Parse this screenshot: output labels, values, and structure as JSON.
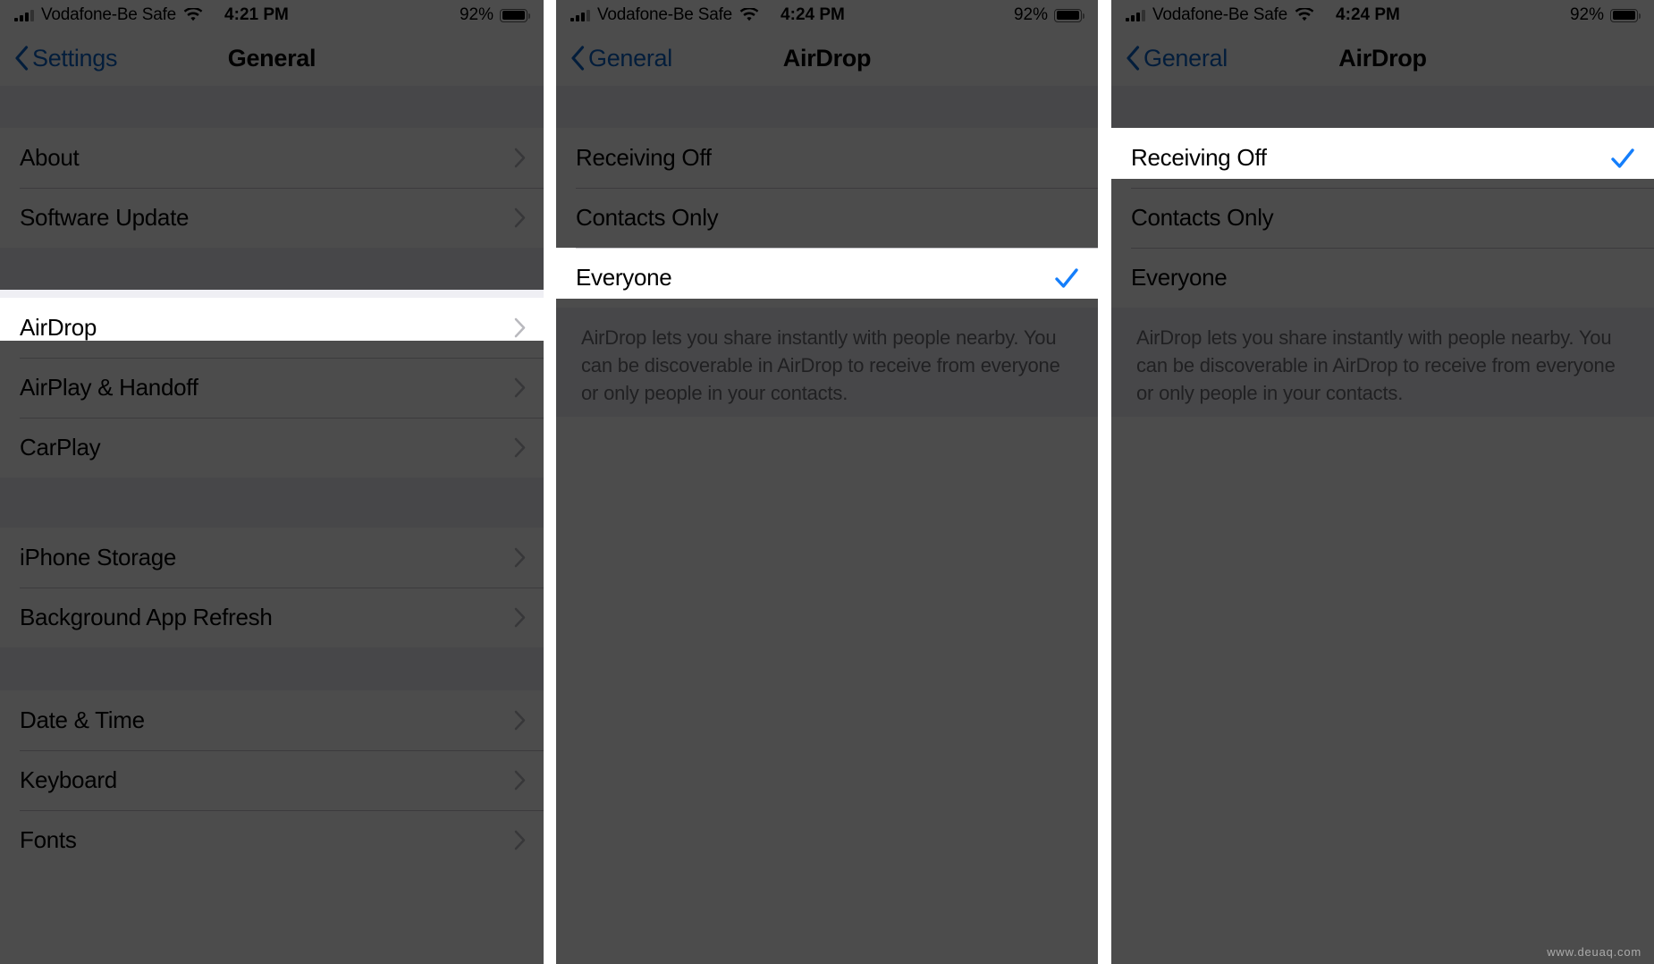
{
  "accent_blue": "#0b63c5",
  "check_blue": "#147efb",
  "dim_color": "rgba(0,0,0,0.70)",
  "watermark": "www.deuaq.com",
  "panels": [
    {
      "id": "general-settings",
      "status": {
        "carrier": "Vodafone-Be Safe",
        "time": "4:21 PM",
        "battery_percent": "92%",
        "signal_icon": "cellular-signal-icon",
        "wifi_icon": "wifi-icon",
        "battery_icon": "battery-icon"
      },
      "nav": {
        "back_label": "Settings",
        "title": "General",
        "back_icon": "chevron-left-icon"
      },
      "groups": [
        {
          "rows": [
            {
              "label": "About",
              "accessory": "chevron-right-icon",
              "highlighted": false
            },
            {
              "label": "Software Update",
              "accessory": "chevron-right-icon",
              "highlighted": false
            }
          ]
        },
        {
          "rows": [
            {
              "label": "AirDrop",
              "accessory": "chevron-right-icon",
              "highlighted": true
            },
            {
              "label": "AirPlay & Handoff",
              "accessory": "chevron-right-icon",
              "highlighted": false
            },
            {
              "label": "CarPlay",
              "accessory": "chevron-right-icon",
              "highlighted": false
            }
          ]
        },
        {
          "rows": [
            {
              "label": "iPhone Storage",
              "accessory": "chevron-right-icon",
              "highlighted": false
            },
            {
              "label": "Background App Refresh",
              "accessory": "chevron-right-icon",
              "highlighted": false
            }
          ]
        },
        {
          "rows": [
            {
              "label": "Date & Time",
              "accessory": "chevron-right-icon",
              "highlighted": false
            },
            {
              "label": "Keyboard",
              "accessory": "chevron-right-icon",
              "highlighted": false
            },
            {
              "label": "Fonts",
              "accessory": "chevron-right-icon",
              "highlighted": false
            }
          ]
        }
      ]
    },
    {
      "id": "airdrop-everyone",
      "status": {
        "carrier": "Vodafone-Be Safe",
        "time": "4:24 PM",
        "battery_percent": "92%",
        "signal_icon": "cellular-signal-icon",
        "wifi_icon": "wifi-icon",
        "battery_icon": "battery-icon"
      },
      "nav": {
        "back_label": "General",
        "title": "AirDrop",
        "back_icon": "chevron-left-icon"
      },
      "groups": [
        {
          "rows": [
            {
              "label": "Receiving Off",
              "accessory": "none",
              "highlighted": false,
              "checked": false
            },
            {
              "label": "Contacts Only",
              "accessory": "none",
              "highlighted": false,
              "checked": false
            },
            {
              "label": "Everyone",
              "accessory": "checkmark-icon",
              "highlighted": true,
              "checked": true
            }
          ]
        }
      ],
      "footnote": "AirDrop lets you share instantly with people nearby. You can be discoverable in AirDrop to receive from everyone or only people in your contacts."
    },
    {
      "id": "airdrop-receiving-off",
      "status": {
        "carrier": "Vodafone-Be Safe",
        "time": "4:24 PM",
        "battery_percent": "92%",
        "signal_icon": "cellular-signal-icon",
        "wifi_icon": "wifi-icon",
        "battery_icon": "battery-icon"
      },
      "nav": {
        "back_label": "General",
        "title": "AirDrop",
        "back_icon": "chevron-left-icon"
      },
      "groups": [
        {
          "rows": [
            {
              "label": "Receiving Off",
              "accessory": "checkmark-icon",
              "highlighted": true,
              "checked": true
            },
            {
              "label": "Contacts Only",
              "accessory": "none",
              "highlighted": false,
              "checked": false
            },
            {
              "label": "Everyone",
              "accessory": "none",
              "highlighted": false,
              "checked": false
            }
          ]
        }
      ],
      "footnote": "AirDrop lets you share instantly with people nearby. You can be discoverable in AirDrop to receive from everyone or only people in your contacts."
    }
  ]
}
